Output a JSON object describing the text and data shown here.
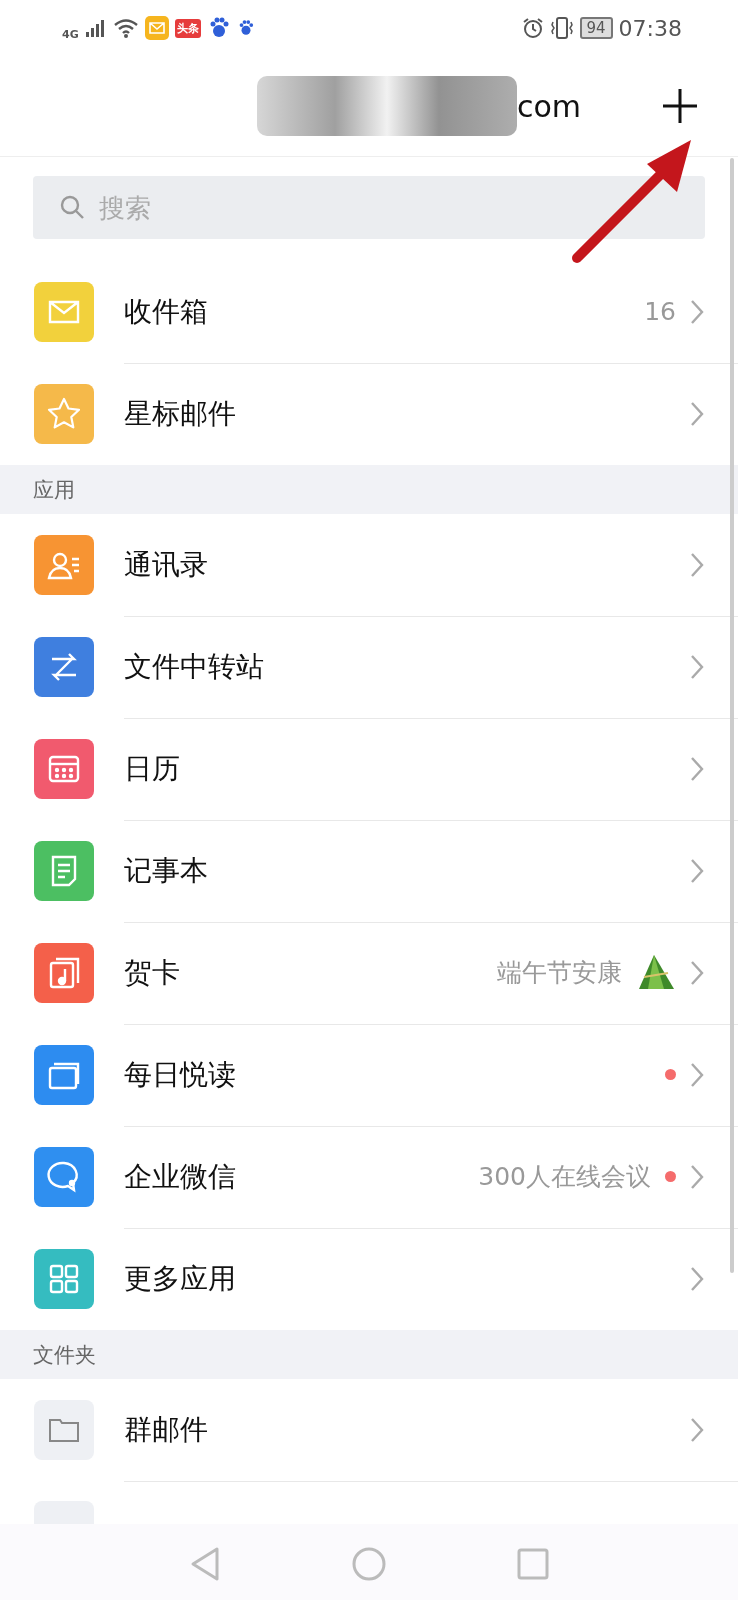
{
  "status_bar": {
    "network": "4G",
    "news_badge": "头条",
    "battery": "94",
    "time": "07:38"
  },
  "header": {
    "title": "com"
  },
  "search": {
    "placeholder": "搜索"
  },
  "mailboxes": [
    {
      "label": "收件箱",
      "color": "#f2d13c",
      "count": "16"
    },
    {
      "label": "星标邮件",
      "color": "#f5b94a"
    }
  ],
  "apps_section": {
    "title": "应用"
  },
  "apps": [
    {
      "label": "通讯录",
      "color": "#f79433",
      "dot": false,
      "sticker": false
    },
    {
      "label": "文件中转站",
      "color": "#3f7fdf",
      "dot": false,
      "sticker": false
    },
    {
      "label": "日历",
      "color": "#f15a6e",
      "dot": false,
      "sticker": false
    },
    {
      "label": "记事本",
      "color": "#4cbf62",
      "dot": false,
      "sticker": false
    },
    {
      "label": "贺卡",
      "color": "#f4604a",
      "note": "端午节安康",
      "dot": false,
      "sticker": true
    },
    {
      "label": "每日悦读",
      "color": "#2d8cf0",
      "dot": true,
      "sticker": false
    },
    {
      "label": "企业微信",
      "color": "#2f8ff0",
      "note": "300人在线会议",
      "dot": true,
      "sticker": false
    },
    {
      "label": "更多应用",
      "color": "#35bcc0",
      "dot": false,
      "sticker": false
    }
  ],
  "folders_section": {
    "title": "文件夹"
  },
  "folders": [
    {
      "label": "群邮件",
      "color": "#eef0f4"
    }
  ]
}
